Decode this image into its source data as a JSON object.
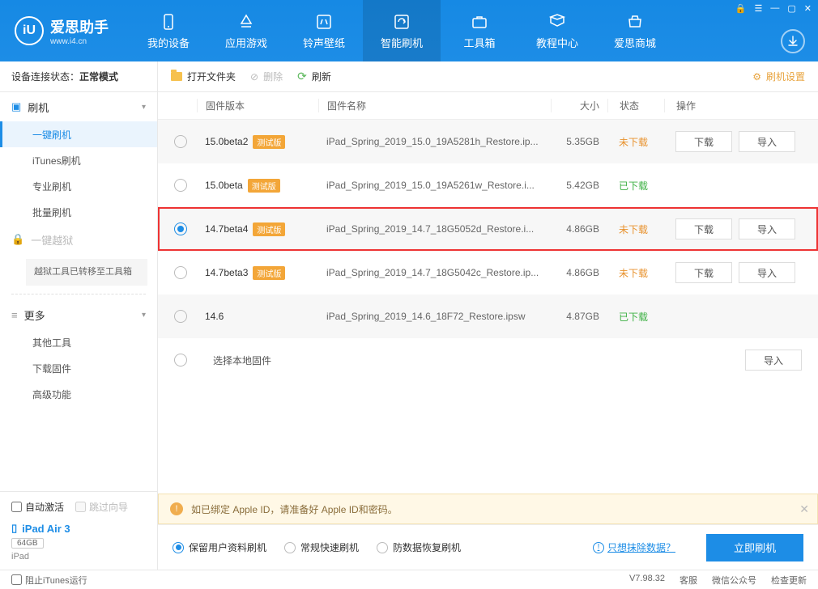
{
  "brand": {
    "name": "爱思助手",
    "site": "www.i4.cn"
  },
  "nav": [
    {
      "label": "我的设备"
    },
    {
      "label": "应用游戏"
    },
    {
      "label": "铃声壁纸"
    },
    {
      "label": "智能刷机"
    },
    {
      "label": "工具箱"
    },
    {
      "label": "教程中心"
    },
    {
      "label": "爱思商城"
    }
  ],
  "conn": {
    "prefix": "设备连接状态：",
    "mode": "正常模式"
  },
  "sidebar": {
    "flash_group": "刷机",
    "items": [
      "一键刷机",
      "iTunes刷机",
      "专业刷机",
      "批量刷机"
    ],
    "jb_group": "一键越狱",
    "jb_note": "越狱工具已转移至工具箱",
    "more_group": "更多",
    "more_items": [
      "其他工具",
      "下载固件",
      "高级功能"
    ]
  },
  "toolbar": {
    "open": "打开文件夹",
    "del": "删除",
    "refresh": "刷新",
    "settings": "刷机设置"
  },
  "columns": {
    "ver": "固件版本",
    "name": "固件名称",
    "size": "大小",
    "status": "状态",
    "ops": "操作"
  },
  "status": {
    "not": "未下载",
    "done": "已下载"
  },
  "buttons": {
    "download": "下载",
    "import": "导入"
  },
  "beta_tag": "测试版",
  "rows": [
    {
      "ver": "15.0beta2",
      "beta": true,
      "name": "iPad_Spring_2019_15.0_19A5281h_Restore.ip...",
      "size": "5.35GB",
      "status": "not",
      "ops": [
        "download",
        "import"
      ],
      "selected": false
    },
    {
      "ver": "15.0beta",
      "beta": true,
      "name": "iPad_Spring_2019_15.0_19A5261w_Restore.i...",
      "size": "5.42GB",
      "status": "done",
      "ops": [],
      "selected": false
    },
    {
      "ver": "14.7beta4",
      "beta": true,
      "name": "iPad_Spring_2019_14.7_18G5052d_Restore.i...",
      "size": "4.86GB",
      "status": "not",
      "ops": [
        "download",
        "import"
      ],
      "selected": true,
      "highlight": true
    },
    {
      "ver": "14.7beta3",
      "beta": true,
      "name": "iPad_Spring_2019_14.7_18G5042c_Restore.ip...",
      "size": "4.86GB",
      "status": "not",
      "ops": [
        "download",
        "import"
      ],
      "selected": false
    },
    {
      "ver": "14.6",
      "beta": false,
      "name": "iPad_Spring_2019_14.6_18F72_Restore.ipsw",
      "size": "4.87GB",
      "status": "done",
      "ops": [],
      "selected": false
    }
  ],
  "local_label": "选择本地固件",
  "warn": "如已绑定 Apple ID，请准备好 Apple ID和密码。",
  "flash_opts": [
    "保留用户资料刷机",
    "常规快速刷机",
    "防数据恢复刷机"
  ],
  "erase_link": "只想抹除数据？",
  "flash_now": "立即刷机",
  "bottom": {
    "auto_activate": "自动激活",
    "skip_guide": "跳过向导",
    "device_name": "iPad Air 3",
    "capacity": "64GB",
    "model": "iPad",
    "block_itunes": "阻止iTunes运行"
  },
  "footer": {
    "version": "V7.98.32",
    "wechat": "微信公众号",
    "service": "客服",
    "update": "检查更新"
  }
}
